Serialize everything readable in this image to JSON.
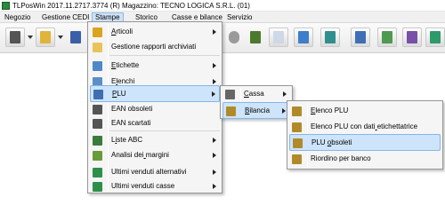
{
  "window": {
    "title": "TLPosWin 2017.11.2717.3774 (R)     Magazzino: TECNO LOGICA S.R.L. (01)"
  },
  "menubar": [
    {
      "label": "Negozio",
      "active": false
    },
    {
      "label": "Gestione CEDI",
      "active": false
    },
    {
      "label": "Stampe",
      "active": true
    },
    {
      "label": "Storico",
      "active": false
    },
    {
      "label": "Casse e bilance",
      "active": false
    },
    {
      "label": "Servizio",
      "active": false
    }
  ],
  "stampe_menu": [
    {
      "label": "Articoli",
      "underline_index": 0,
      "submenu": true,
      "icon": "book-icon",
      "color": "#d9a520"
    },
    {
      "label": "Gestione rapporti archiviati",
      "underline_index": -1,
      "submenu": false,
      "icon": "folder-icon",
      "color": "#e8c35a"
    },
    {
      "label": "Etichette",
      "underline_index": 0,
      "submenu": true,
      "icon": "label-icon",
      "color": "#4e88c6"
    },
    {
      "label": "Elenchi",
      "underline_index": 1,
      "submenu": true,
      "icon": "list-icon",
      "color": "#5b8fc8"
    },
    {
      "label": "PLU",
      "underline_index": 0,
      "submenu": true,
      "icon": "plu-icon",
      "color": "#3f6fb0",
      "highlighted": true
    },
    {
      "label": "EAN obsoleti",
      "underline_index": -1,
      "submenu": false,
      "icon": "barcode-icon",
      "color": "#555555"
    },
    {
      "label": "EAN scartati",
      "underline_index": -1,
      "submenu": false,
      "icon": "barcode-icon",
      "color": "#555555"
    },
    {
      "label": "Liste ABC",
      "underline_index": 1,
      "submenu": true,
      "icon": "abc-icon",
      "color": "#3c7a3c"
    },
    {
      "label": "Analisi dei margini",
      "underline_index": 11,
      "submenu": true,
      "icon": "chart-icon",
      "color": "#6a9b3a"
    },
    {
      "label": "Ultimi venduti alternativi",
      "underline_index": -1,
      "submenu": true,
      "icon": "sheet-icon",
      "color": "#2f8f4a"
    },
    {
      "label": "Ultimi venduti casse",
      "underline_index": -1,
      "submenu": true,
      "icon": "sheet-icon",
      "color": "#2f8f4a"
    }
  ],
  "plu_menu": [
    {
      "label": "Cassa",
      "underline_index": 0,
      "submenu": true,
      "icon": "cash-register-icon",
      "color": "#666666"
    },
    {
      "label": "Bilancia",
      "underline_index": 0,
      "submenu": true,
      "icon": "scale-icon",
      "color": "#b08a2a",
      "highlighted": true
    }
  ],
  "bilancia_menu": [
    {
      "label": "Elenco PLU",
      "underline_index": 0,
      "icon": "scale-icon",
      "color": "#b08a2a"
    },
    {
      "label": "Elenco PLU con dati etichettatrice",
      "underline_index": 19,
      "icon": "scale-icon",
      "color": "#b08a2a"
    },
    {
      "label": "PLU obsoleti",
      "underline_index": 4,
      "icon": "scale-icon",
      "color": "#b08a2a",
      "highlighted": true
    },
    {
      "label": "Riordino per banco",
      "underline_index": -1,
      "icon": "scale-icon",
      "color": "#b08a2a"
    }
  ]
}
